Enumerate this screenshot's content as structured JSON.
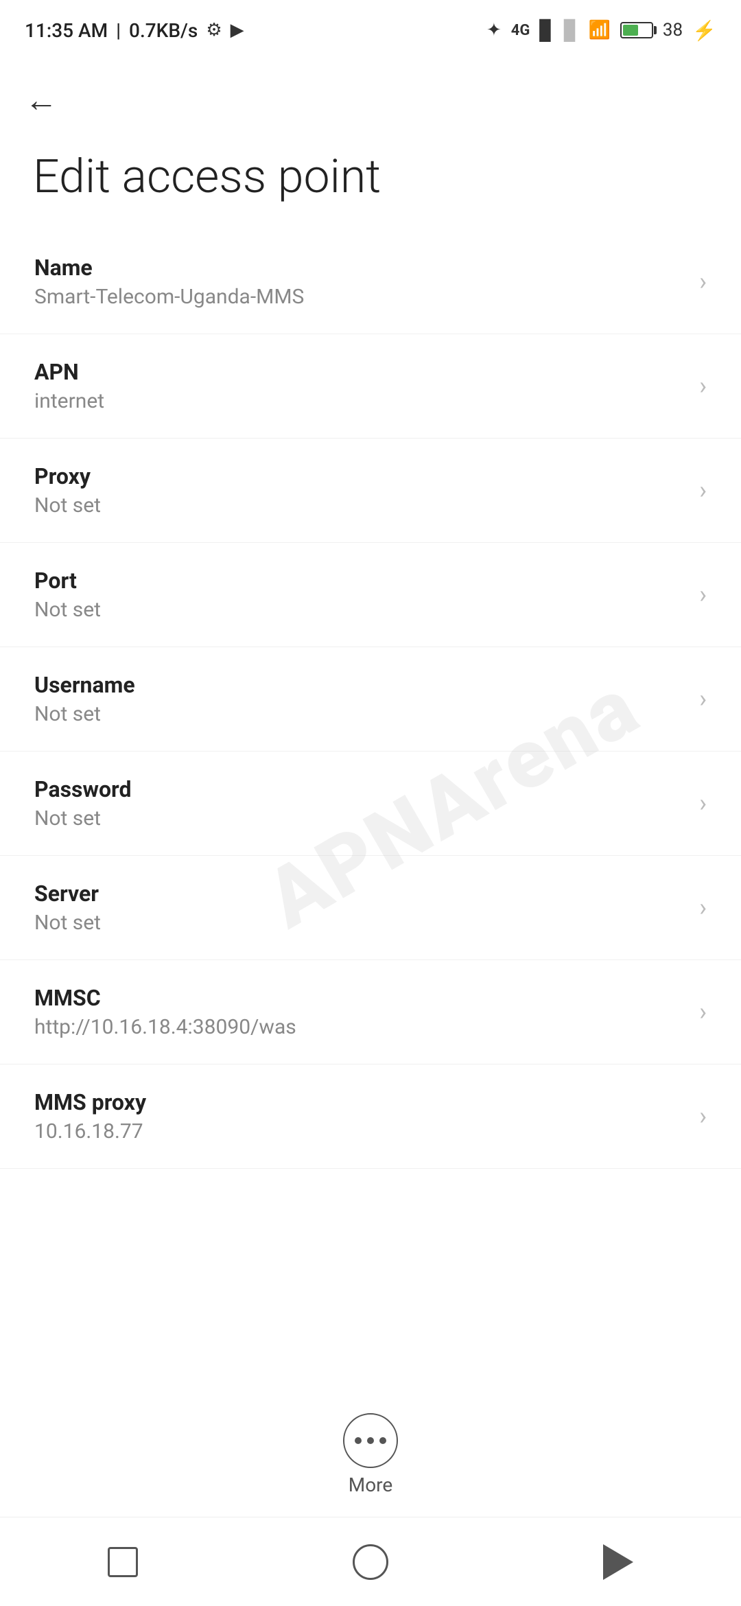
{
  "statusBar": {
    "time": "11:35 AM",
    "speed": "0.7KB/s"
  },
  "header": {
    "backArrow": "←"
  },
  "pageTitle": "Edit access point",
  "settings": [
    {
      "label": "Name",
      "value": "Smart-Telecom-Uganda-MMS"
    },
    {
      "label": "APN",
      "value": "internet"
    },
    {
      "label": "Proxy",
      "value": "Not set"
    },
    {
      "label": "Port",
      "value": "Not set"
    },
    {
      "label": "Username",
      "value": "Not set"
    },
    {
      "label": "Password",
      "value": "Not set"
    },
    {
      "label": "Server",
      "value": "Not set"
    },
    {
      "label": "MMSC",
      "value": "http://10.16.18.4:38090/was"
    },
    {
      "label": "MMS proxy",
      "value": "10.16.18.77"
    }
  ],
  "more": {
    "label": "More"
  },
  "watermark": "APNArena"
}
